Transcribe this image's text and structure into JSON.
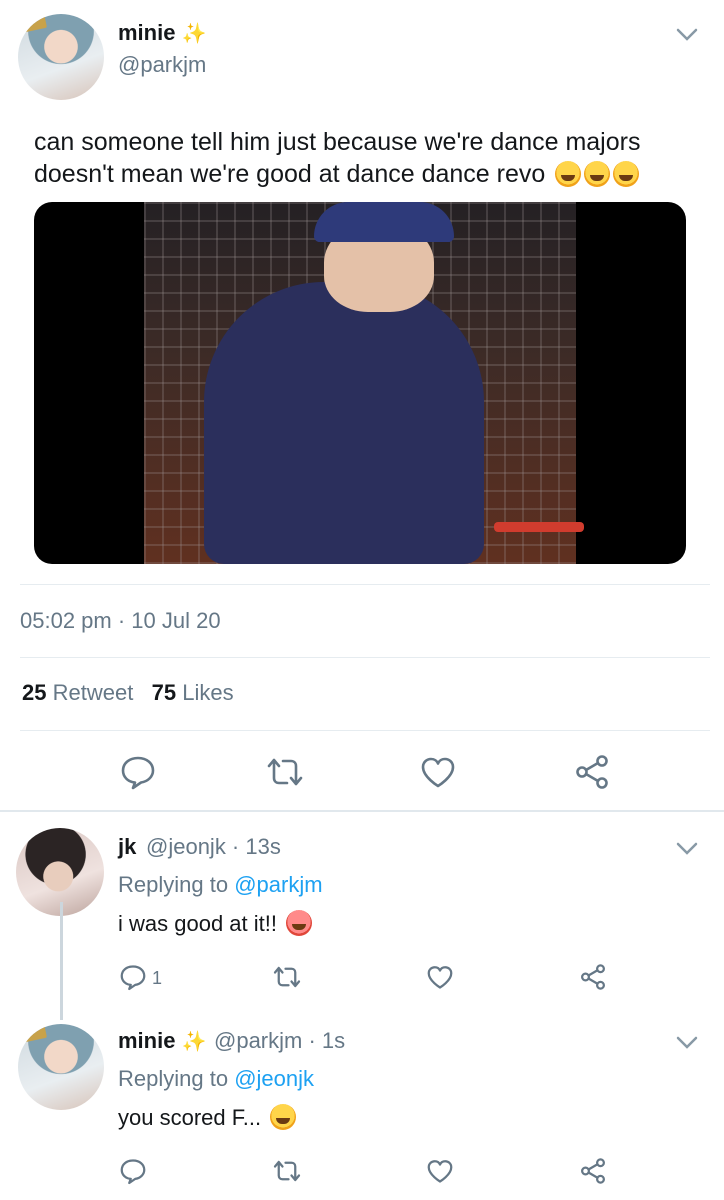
{
  "main_tweet": {
    "display_name": "minie",
    "verified_emoji": "✨",
    "handle": "@parkjm",
    "text": "can someone tell him just because we're dance majors doesn't mean we're good at dance dance revo",
    "emojis": [
      "rofl-emoji",
      "rofl-emoji",
      "rofl-emoji"
    ],
    "timestamp": "05:02 pm · 10 Jul 20",
    "retweet_count": "25",
    "retweet_label": "Retweet",
    "likes_count": "75",
    "likes_label": "Likes",
    "actions": [
      "reply-icon",
      "retweet-icon",
      "heart-icon",
      "share-icon"
    ]
  },
  "replies": [
    {
      "display_name": "jk",
      "handle_meta": "@jeonjk · 13s",
      "replying_prefix": "Replying to",
      "replying_to": "@parkjm",
      "text": "i was good at it!!",
      "emoji": "tired-face-emoji",
      "reply_count": "1"
    },
    {
      "display_name": "minie",
      "verified_emoji": "✨",
      "handle_meta": "@parkjm · 1s",
      "replying_prefix": "Replying to",
      "replying_to": "@jeonjk",
      "text": "you scored F...",
      "emoji": "rofl-emoji",
      "reply_count": ""
    }
  ],
  "colors": {
    "link": "#1da1f2",
    "secondary_text": "#657786",
    "primary_text": "#14171a",
    "divider": "#e6ecf0"
  }
}
